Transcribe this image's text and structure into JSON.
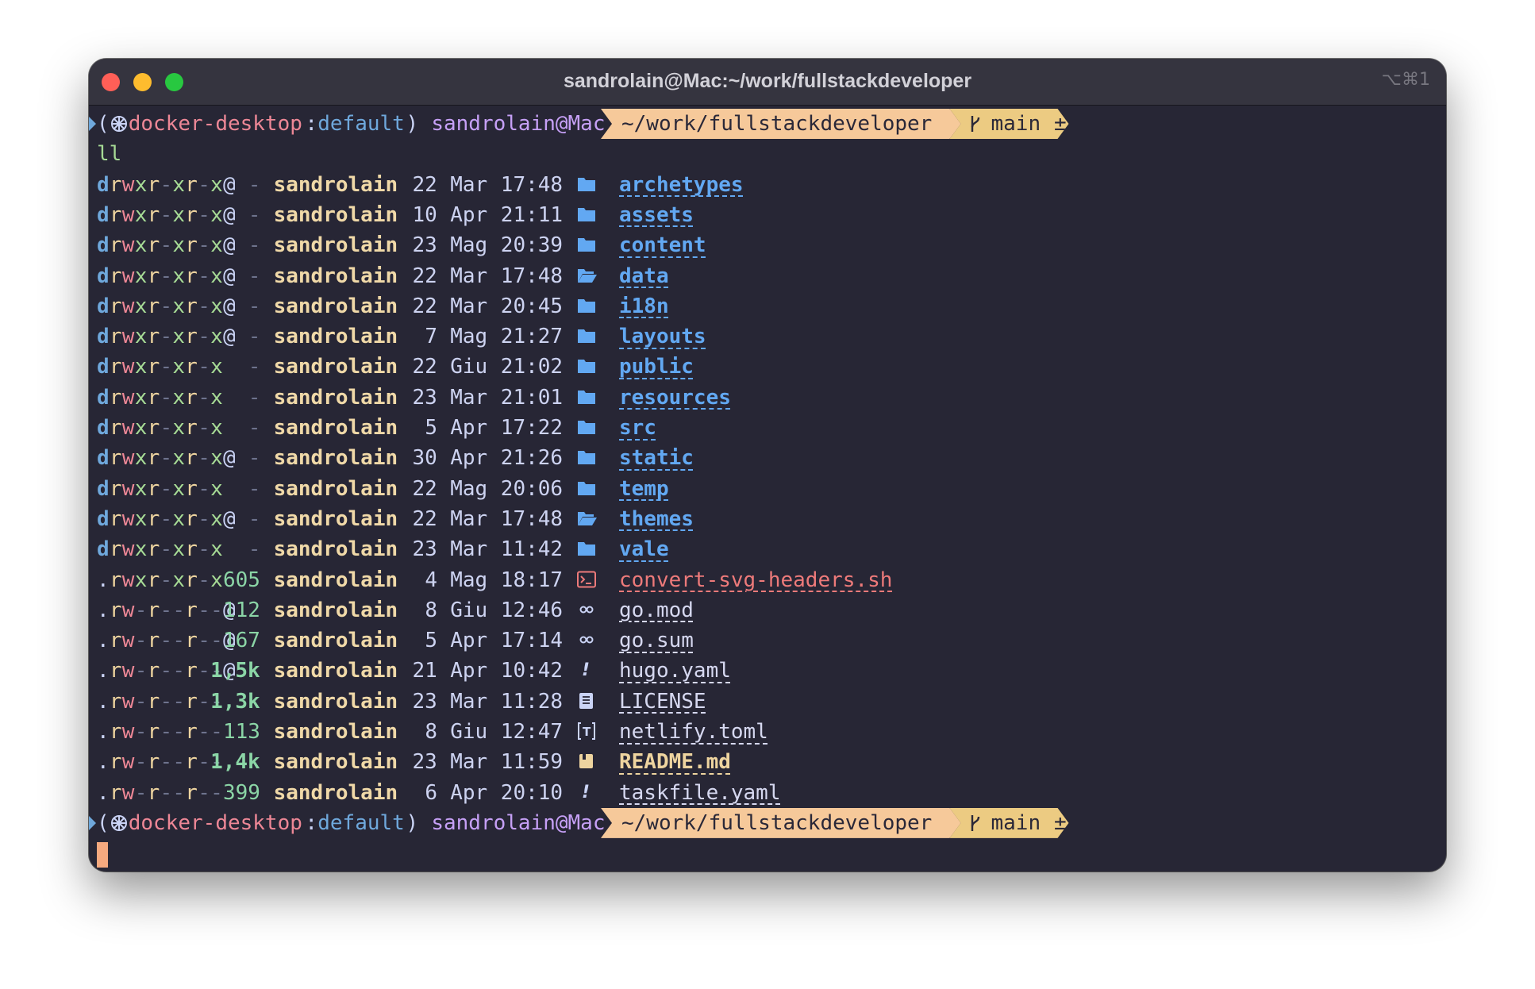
{
  "window": {
    "title": "sandrolain@Mac:~/work/fullstackdeveloper",
    "shortcut": "⌥⌘1"
  },
  "prompt": {
    "open_paren": "(",
    "kube_context": "docker-desktop",
    "colon": ":",
    "kube_namespace": "default",
    "close_paren": ")",
    "user_host": "sandrolain@Mac",
    "path": "~/work/fullstackdeveloper",
    "git_branch": "main",
    "git_status": "±"
  },
  "command": "ll",
  "listing": [
    {
      "perm": "drwxr-xr-x@",
      "size": "-",
      "owner": "sandrolain",
      "day": "22",
      "month": "Mar",
      "time": "17:48",
      "name": "archetypes",
      "kind": "dir",
      "icon": "folder-icon"
    },
    {
      "perm": "drwxr-xr-x@",
      "size": "-",
      "owner": "sandrolain",
      "day": "10",
      "month": "Apr",
      "time": "21:11",
      "name": "assets",
      "kind": "dir",
      "icon": "folder-icon"
    },
    {
      "perm": "drwxr-xr-x@",
      "size": "-",
      "owner": "sandrolain",
      "day": "23",
      "month": "Mag",
      "time": "20:39",
      "name": "content",
      "kind": "dir",
      "icon": "folder-icon"
    },
    {
      "perm": "drwxr-xr-x@",
      "size": "-",
      "owner": "sandrolain",
      "day": "22",
      "month": "Mar",
      "time": "17:48",
      "name": "data",
      "kind": "dir",
      "icon": "folder-open-icon"
    },
    {
      "perm": "drwxr-xr-x@",
      "size": "-",
      "owner": "sandrolain",
      "day": "22",
      "month": "Mar",
      "time": "20:45",
      "name": "i18n",
      "kind": "dir",
      "icon": "folder-icon"
    },
    {
      "perm": "drwxr-xr-x@",
      "size": "-",
      "owner": "sandrolain",
      "day": "7",
      "month": "Mag",
      "time": "21:27",
      "name": "layouts",
      "kind": "dir",
      "icon": "folder-icon"
    },
    {
      "perm": "drwxr-xr-x",
      "size": "-",
      "owner": "sandrolain",
      "day": "22",
      "month": "Giu",
      "time": "21:02",
      "name": "public",
      "kind": "dir",
      "icon": "folder-icon"
    },
    {
      "perm": "drwxr-xr-x",
      "size": "-",
      "owner": "sandrolain",
      "day": "23",
      "month": "Mar",
      "time": "21:01",
      "name": "resources",
      "kind": "dir",
      "icon": "folder-icon"
    },
    {
      "perm": "drwxr-xr-x",
      "size": "-",
      "owner": "sandrolain",
      "day": "5",
      "month": "Apr",
      "time": "17:22",
      "name": "src",
      "kind": "dir",
      "icon": "folder-icon"
    },
    {
      "perm": "drwxr-xr-x@",
      "size": "-",
      "owner": "sandrolain",
      "day": "30",
      "month": "Apr",
      "time": "21:26",
      "name": "static",
      "kind": "dir",
      "icon": "folder-icon"
    },
    {
      "perm": "drwxr-xr-x",
      "size": "-",
      "owner": "sandrolain",
      "day": "22",
      "month": "Mag",
      "time": "20:06",
      "name": "temp",
      "kind": "dir",
      "icon": "folder-icon"
    },
    {
      "perm": "drwxr-xr-x@",
      "size": "-",
      "owner": "sandrolain",
      "day": "22",
      "month": "Mar",
      "time": "17:48",
      "name": "themes",
      "kind": "dir",
      "icon": "folder-open-icon"
    },
    {
      "perm": "drwxr-xr-x",
      "size": "-",
      "owner": "sandrolain",
      "day": "23",
      "month": "Mar",
      "time": "11:42",
      "name": "vale",
      "kind": "dir",
      "icon": "folder-icon"
    },
    {
      "perm": ".rwxr-xr-x",
      "size": "605",
      "owner": "sandrolain",
      "day": "4",
      "month": "Mag",
      "time": "18:17",
      "name": "convert-svg-headers.sh",
      "kind": "exe",
      "icon": "terminal-icon"
    },
    {
      "perm": ".rw-r--r--@",
      "size": "112",
      "owner": "sandrolain",
      "day": "8",
      "month": "Giu",
      "time": "12:46",
      "name": "go.mod",
      "kind": "file",
      "icon": "link-icon"
    },
    {
      "perm": ".rw-r--r--@",
      "size": "167",
      "owner": "sandrolain",
      "day": "5",
      "month": "Apr",
      "time": "17:14",
      "name": "go.sum",
      "kind": "file",
      "icon": "link-icon"
    },
    {
      "perm": ".rw-r--r--@",
      "size": "1,5k",
      "owner": "sandrolain",
      "day": "21",
      "month": "Apr",
      "time": "10:42",
      "name": "hugo.yaml",
      "kind": "file",
      "icon": "exclamation-icon"
    },
    {
      "perm": ".rw-r--r--",
      "size": "1,3k",
      "owner": "sandrolain",
      "day": "23",
      "month": "Mar",
      "time": "11:28",
      "name": "LICENSE",
      "kind": "file",
      "icon": "book-icon"
    },
    {
      "perm": ".rw-r--r--",
      "size": "113",
      "owner": "sandrolain",
      "day": "8",
      "month": "Giu",
      "time": "12:47",
      "name": "netlify.toml",
      "kind": "file",
      "icon": "toml-icon"
    },
    {
      "perm": ".rw-r--r--",
      "size": "1,4k",
      "owner": "sandrolain",
      "day": "23",
      "month": "Mar",
      "time": "11:59",
      "name": "README.md",
      "kind": "readme",
      "icon": "readme-icon"
    },
    {
      "perm": ".rw-r--r--",
      "size": "399",
      "owner": "sandrolain",
      "day": "6",
      "month": "Apr",
      "time": "20:10",
      "name": "taskfile.yaml",
      "kind": "file",
      "icon": "exclamation-icon"
    }
  ],
  "colors": {
    "background": "#272635",
    "titlebar": "#35343f",
    "path_segment": "#f6c99a",
    "git_segment": "#eccb82",
    "cursor": "#f5a97f"
  }
}
